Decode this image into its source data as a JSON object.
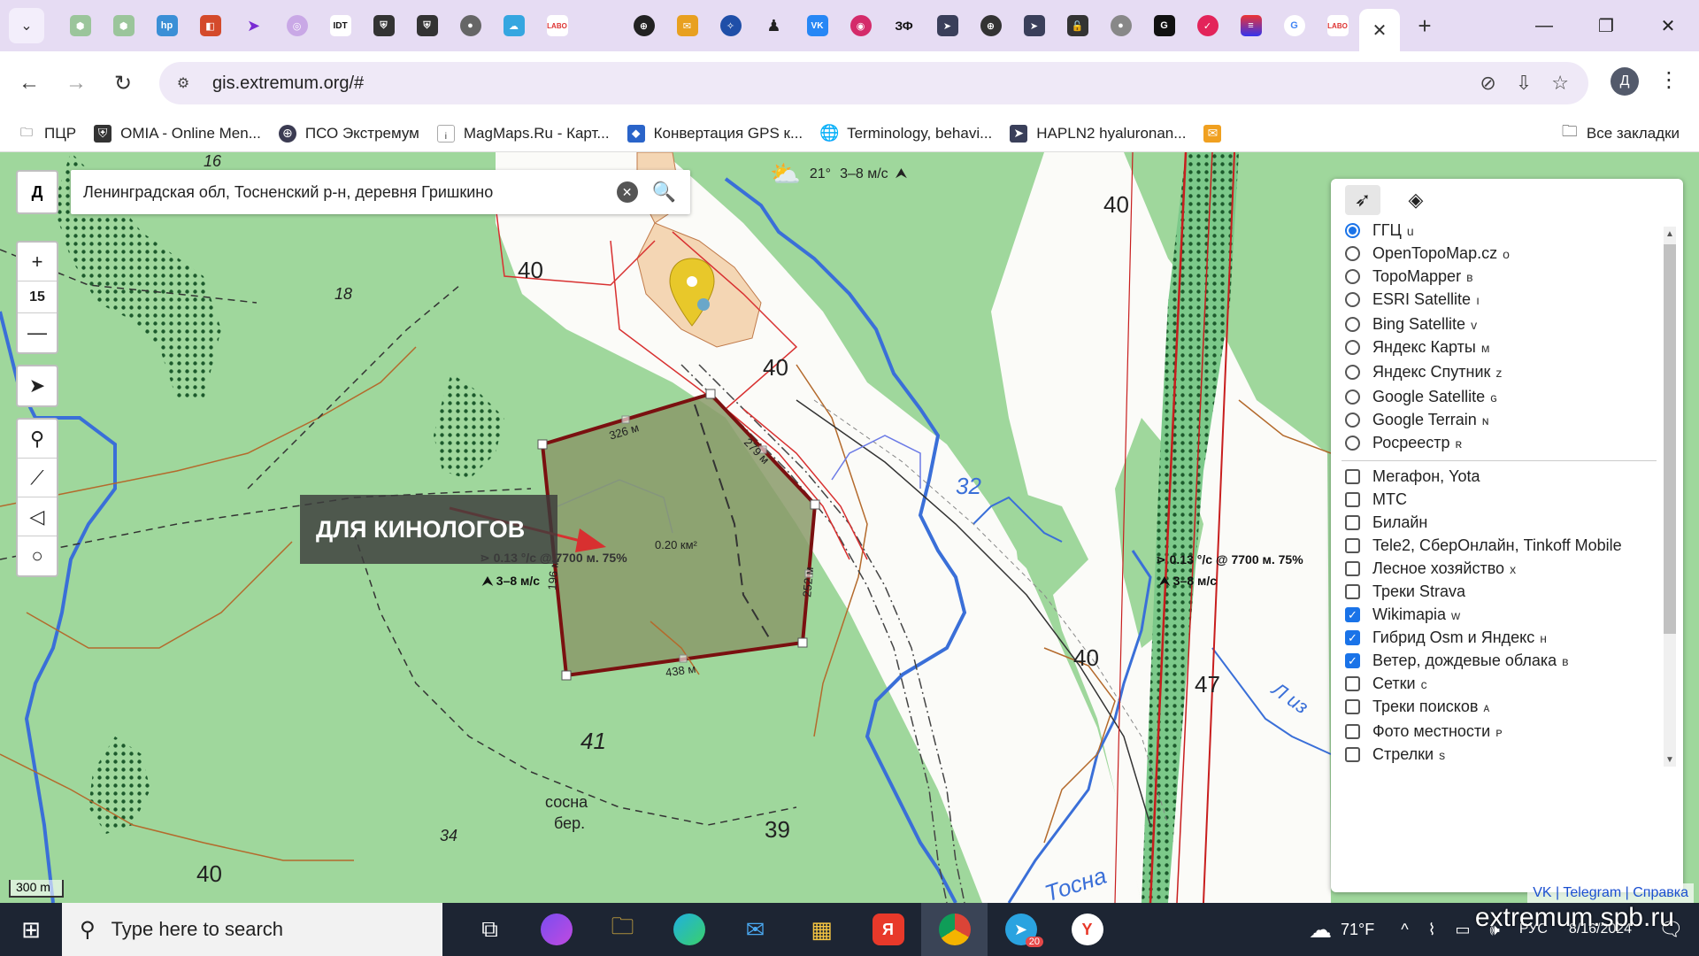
{
  "browser": {
    "tab_favicons": [
      "hex-green",
      "hex-green",
      "hp",
      "mixed",
      "purple-arrow",
      "ring",
      "IDT",
      "shield",
      "shield",
      "globe",
      "cloud",
      "LABO KLIN",
      "blank",
      "target",
      "mail",
      "compass",
      "chip",
      "VK",
      "rings",
      "ЗФ",
      "arrow-gold",
      "globe",
      "arrow-gold",
      "lock",
      "globe",
      "G-square",
      "yandex-music",
      "menu-colors",
      "Google",
      "LABO KLIN"
    ],
    "active_tab_close": "✕",
    "new_tab": "+",
    "url": "gis.extremum.org/#",
    "avatar_letter": "Д"
  },
  "bookmarks": [
    {
      "label": "ПЦР",
      "icon": "folder"
    },
    {
      "label": "OMIA - Online Men...",
      "icon": "omia"
    },
    {
      "label": "ПСО Экстремум",
      "icon": "pso"
    },
    {
      "label": "MagMaps.Ru - Карт...",
      "icon": "magmaps"
    },
    {
      "label": "Конвертация GPS к...",
      "icon": "gps"
    },
    {
      "label": "Terminology, behavi...",
      "icon": "globe"
    },
    {
      "label": "HAPLN2 hyaluronan...",
      "icon": "arrow"
    },
    {
      "label": "",
      "icon": "mail"
    }
  ],
  "bookmarks_all": "Все закладки",
  "map": {
    "search_prefix": "Д",
    "search_text": "Ленинградская обл, Тосненский р-н, деревня Гришкино",
    "zoom_level": "15",
    "weather": {
      "temp": "21°",
      "wind": "3–8 м/с"
    },
    "banner": "ДЛЯ КИНОЛОГОВ",
    "area": "0.20 км²",
    "measurements": [
      "326 м",
      "279 м",
      "252 м",
      "438 м",
      "196 м"
    ],
    "wind_polygon": {
      "line1": "0.13 °/с @ 7700 м. 75%",
      "line2": "3–8 м/с"
    },
    "wind_right": {
      "line1": "0.13 °/с @ 7700 м. 75%",
      "line2": "3–8 м/с"
    },
    "labels": {
      "l40a": "40",
      "l40b": "40",
      "l40c": "40",
      "l40d": "40",
      "l40e": "40",
      "l18": "18",
      "l16": "16",
      "l41": "41",
      "l39": "39",
      "l47": "47",
      "l34": "34",
      "l32": "32",
      "forest1": "сосна",
      "forest2": "бер.",
      "river": "Тосна",
      "river2": "Л из"
    },
    "scale": "300 m",
    "attribution": {
      "vk": "VK",
      "sep": "|",
      "telegram": "Telegram",
      "help": "Справка"
    },
    "watermark": "extremum.spb.ru"
  },
  "layers": {
    "base": [
      {
        "label": "ГГЦ",
        "key": "u",
        "selected": true
      },
      {
        "label": "OpenTopoMap.cz",
        "key": "o",
        "selected": false
      },
      {
        "label": "TopoMapper",
        "key": "в",
        "selected": false
      },
      {
        "label": "ESRI Satellite",
        "key": "ı",
        "selected": false
      },
      {
        "label": "Bing Satellite",
        "key": "v",
        "selected": false
      },
      {
        "label": "Яндекс Карты",
        "key": "м",
        "selected": false
      },
      {
        "label": "Яндекс Спутник",
        "key": "z",
        "selected": false
      },
      {
        "label": "Google Satellite",
        "key": "ɢ",
        "selected": false
      },
      {
        "label": "Google Terrain",
        "key": "ɴ",
        "selected": false
      },
      {
        "label": "Росреестр",
        "key": "ʀ",
        "selected": false
      }
    ],
    "overlays": [
      {
        "label": "Мегафон, Yota",
        "key": "",
        "checked": false
      },
      {
        "label": "МТС",
        "key": "",
        "checked": false
      },
      {
        "label": "Билайн",
        "key": "",
        "checked": false
      },
      {
        "label": "Tele2, СберОнлайн, Tinkoff Mobile",
        "key": "",
        "checked": false
      },
      {
        "label": "Лесное хозяйство",
        "key": "x",
        "checked": false
      },
      {
        "label": "Треки Strava",
        "key": "",
        "checked": false
      },
      {
        "label": "Wikimapia",
        "key": "w",
        "checked": true
      },
      {
        "label": "Гибрид Osm и Яндекс",
        "key": "н",
        "checked": true
      },
      {
        "label": "Ветер, дождевые облака",
        "key": "в",
        "checked": true
      },
      {
        "label": "Сетки",
        "key": "с",
        "checked": false
      },
      {
        "label": "Треки поисков",
        "key": "ᴀ",
        "checked": false
      },
      {
        "label": "Фото местности",
        "key": "ᴘ",
        "checked": false
      },
      {
        "label": "Стрелки",
        "key": "s",
        "checked": false
      }
    ]
  },
  "taskbar": {
    "search_placeholder": "Type here to search",
    "weather_temp": "71°F",
    "weather_badge": "1",
    "lang": "РУС",
    "time": "",
    "date": "8/16/2024",
    "telegram_badge": "20",
    "notif_badge": "2"
  }
}
